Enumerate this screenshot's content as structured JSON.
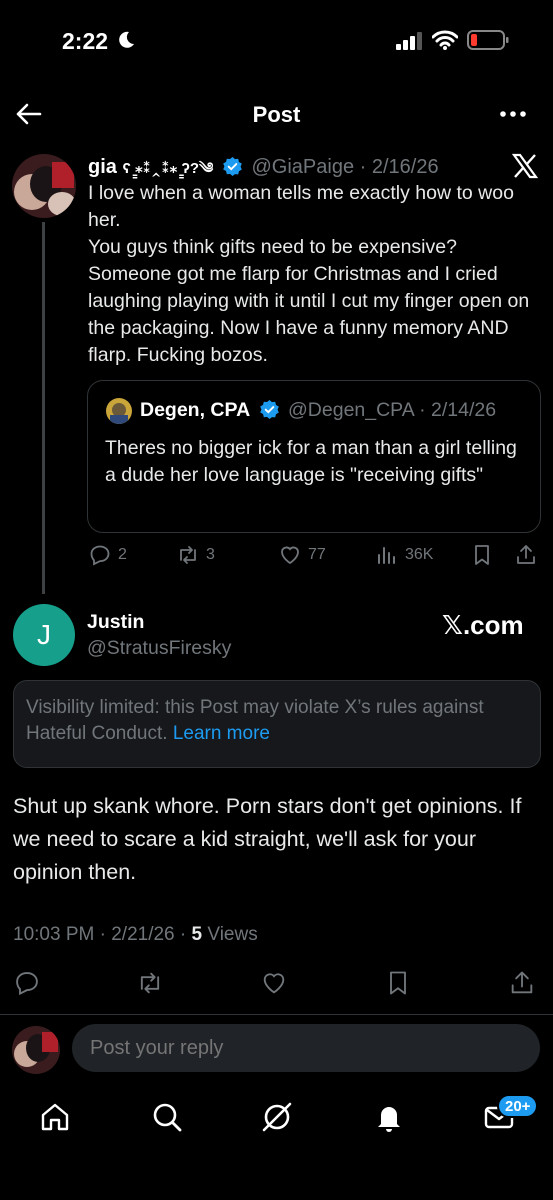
{
  "status_bar": {
    "time": "2:22"
  },
  "header": {
    "title": "Post"
  },
  "quoted_thread": {
    "author_name": "gia",
    "author_emoji": "ʕ ̳⁎⁑‸⁑⁎ ̳ʔ?༄",
    "handle": "@GiaPaige",
    "date": "2/16/26",
    "text": "I love when a woman tells me exactly how to woo her.\nYou guys think gifts need to be expensive? Someone got me flarp for Christmas and I cried laughing playing with it until I cut my finger open on the packaging. Now I have a funny memory AND flarp. Fucking bozos.",
    "quote": {
      "author_name": "Degen, CPA",
      "handle": "@Degen_CPA",
      "date": "2/14/26",
      "text": "Theres no bigger ick for a man than a girl telling a dude her love language is \"receiving gifts\""
    },
    "stats": {
      "replies": "2",
      "reposts": "3",
      "likes": "77",
      "views": "36K"
    }
  },
  "post": {
    "author_name": "Justin",
    "handle": "@StratusFiresky",
    "avatar_letter": "J",
    "watermark": "𝕏.com",
    "visibility_notice": "Visibility limited: this Post may violate X’s rules against Hateful Conduct.",
    "learn_more": "Learn more",
    "text": "Shut up skank whore.  Porn stars don't get opinions.  If we need to scare a kid straight, we'll ask for your opinion then.",
    "time": "10:03 PM",
    "date": "2/21/26",
    "views_count": "5",
    "views_label": "Views"
  },
  "reply_box": {
    "placeholder": "Post your reply"
  },
  "bottom_nav": {
    "notification_badge": "20+"
  },
  "colors": {
    "accent": "#1d9bf0",
    "muted": "#71767b",
    "avatar_j": "#16a08b"
  }
}
